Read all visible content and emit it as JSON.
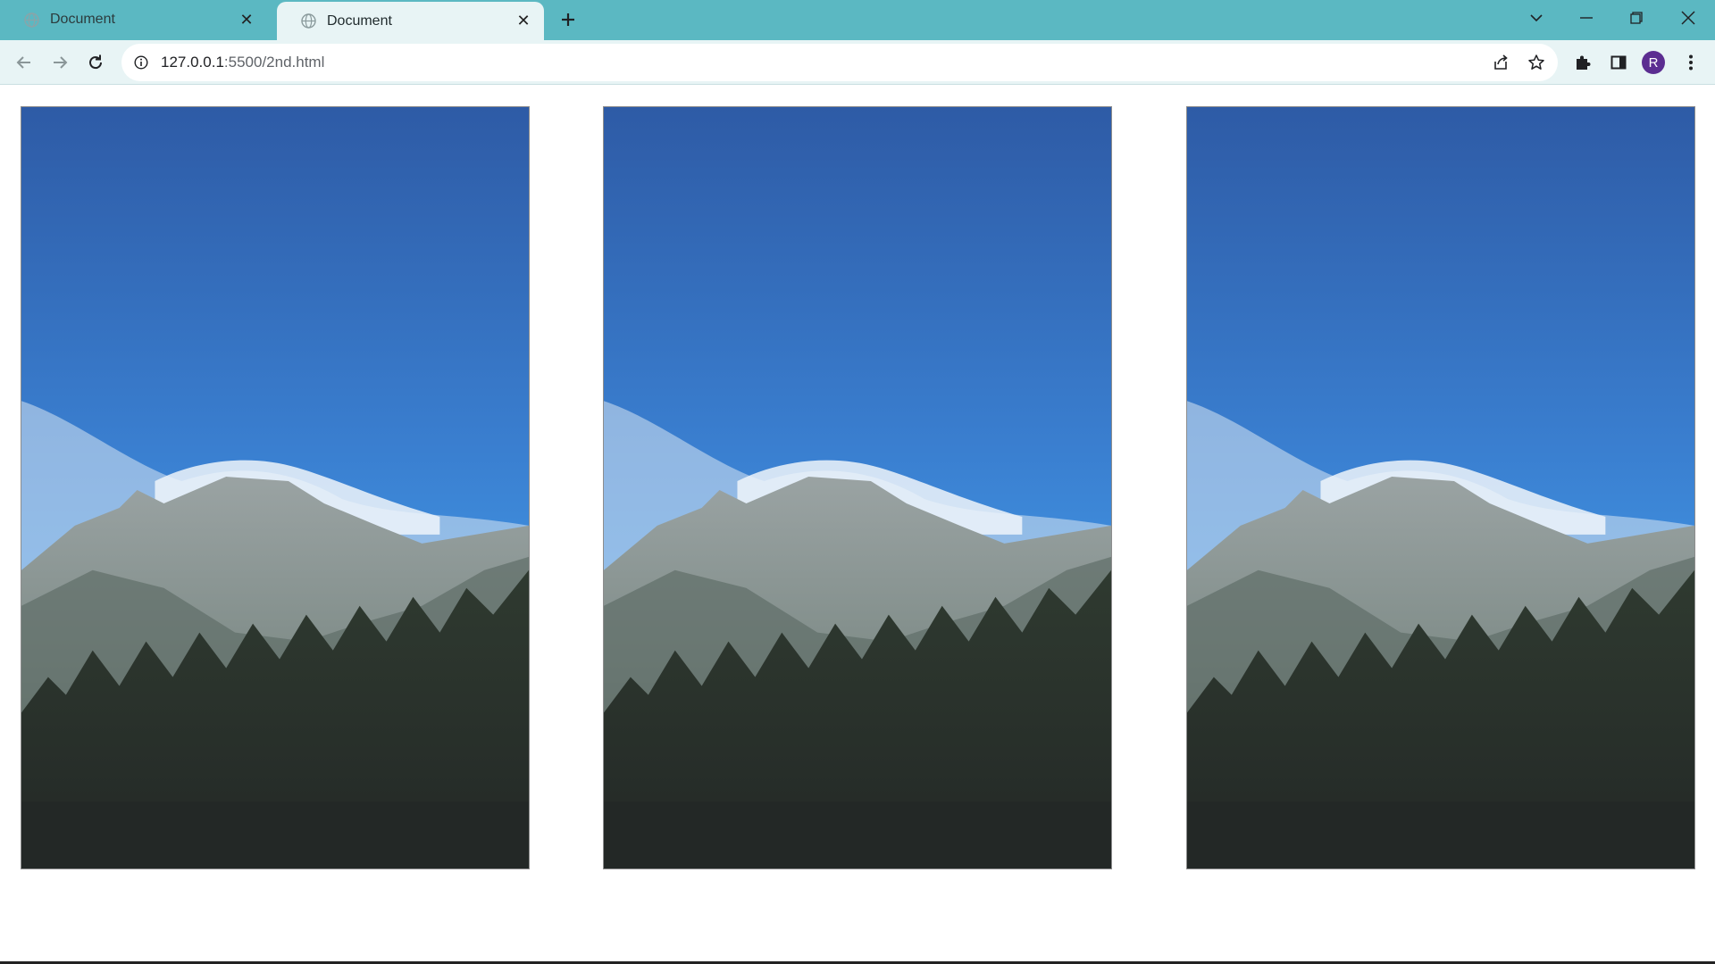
{
  "browser": {
    "tabs": [
      {
        "title": "Document",
        "active": false
      },
      {
        "title": "Document",
        "active": true
      }
    ],
    "address": {
      "host": "127.0.0.1",
      "path": ":5500/2nd.html"
    },
    "profile_initial": "R"
  },
  "page": {
    "images": [
      {
        "subject": "mountain peak with forest under blue sky"
      },
      {
        "subject": "mountain peak with forest under blue sky"
      },
      {
        "subject": "mountain peak with forest under blue sky"
      }
    ]
  },
  "colors": {
    "titlebar": "#5bb8c2",
    "toolbar": "#e8f4f5",
    "sky_top": "#2e5ba6",
    "sky_bottom": "#3a86d6",
    "forest": "#242a22",
    "avatar": "#5b2d91"
  }
}
